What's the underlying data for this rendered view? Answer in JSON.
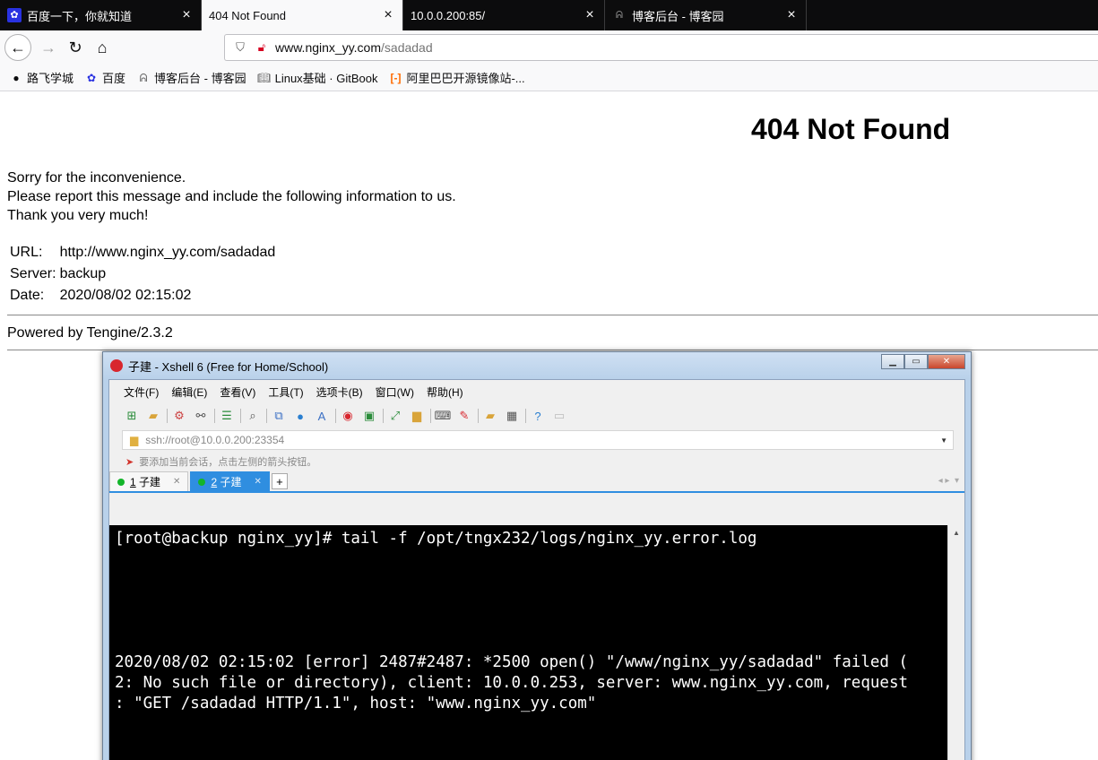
{
  "browser": {
    "tabs": [
      {
        "title": "百度一下，你就知道",
        "icon": "baidu-icon",
        "active": false
      },
      {
        "title": "404 Not Found",
        "icon": "",
        "active": true
      },
      {
        "title": "10.0.0.200:85/",
        "icon": "",
        "active": false
      },
      {
        "title": "博客后台 - 博客园",
        "icon": "cnblogs-icon",
        "active": false
      }
    ],
    "url": {
      "host": "www.nginx_yy.com",
      "path": "/sadadad"
    },
    "bookmarks": [
      {
        "label": "路飞学城",
        "icon": "luffy-icon"
      },
      {
        "label": "百度",
        "icon": "baidu-icon"
      },
      {
        "label": "博客后台 - 博客园",
        "icon": "cnblogs-icon"
      },
      {
        "label": "Linux基础 · GitBook",
        "icon": "book-icon"
      },
      {
        "label": "阿里巴巴开源镜像站-...",
        "icon": "aliyun-icon"
      }
    ]
  },
  "page": {
    "title": "404 Not Found",
    "lines": [
      "Sorry for the inconvenience.",
      "Please report this message and include the following information to us.",
      "Thank you very much!"
    ],
    "info": [
      {
        "label": "URL:",
        "value": "http://www.nginx_yy.com/sadadad"
      },
      {
        "label": "Server:",
        "value": "backup"
      },
      {
        "label": "Date:",
        "value": "2020/08/02 02:15:02"
      }
    ],
    "powered": "Powered by Tengine/2.3.2"
  },
  "xshell": {
    "title": "子建 - Xshell 6 (Free for Home/School)",
    "menus": [
      "文件(F)",
      "编辑(E)",
      "查看(V)",
      "工具(T)",
      "选项卡(B)",
      "窗口(W)",
      "帮助(H)"
    ],
    "address": "ssh://root@10.0.0.200:23354",
    "hint": "要添加当前会话，点击左侧的箭头按钮。",
    "tabs": [
      {
        "num": "1",
        "label": "子建",
        "active": false
      },
      {
        "num": "2",
        "label": "子建",
        "active": true
      }
    ],
    "terminal_lines": [
      "[root@backup nginx_yy]# tail -f /opt/tngx232/logs/nginx_yy.error.log",
      "",
      "",
      "",
      "",
      "",
      "2020/08/02 02:15:02 [error] 2487#2487: *2500 open() \"/www/nginx_yy/sadadad\" failed (",
      "2: No such file or directory), client: 10.0.0.253, server: www.nginx_yy.com, request",
      ": \"GET /sadadad HTTP/1.1\", host: \"www.nginx_yy.com\""
    ]
  }
}
